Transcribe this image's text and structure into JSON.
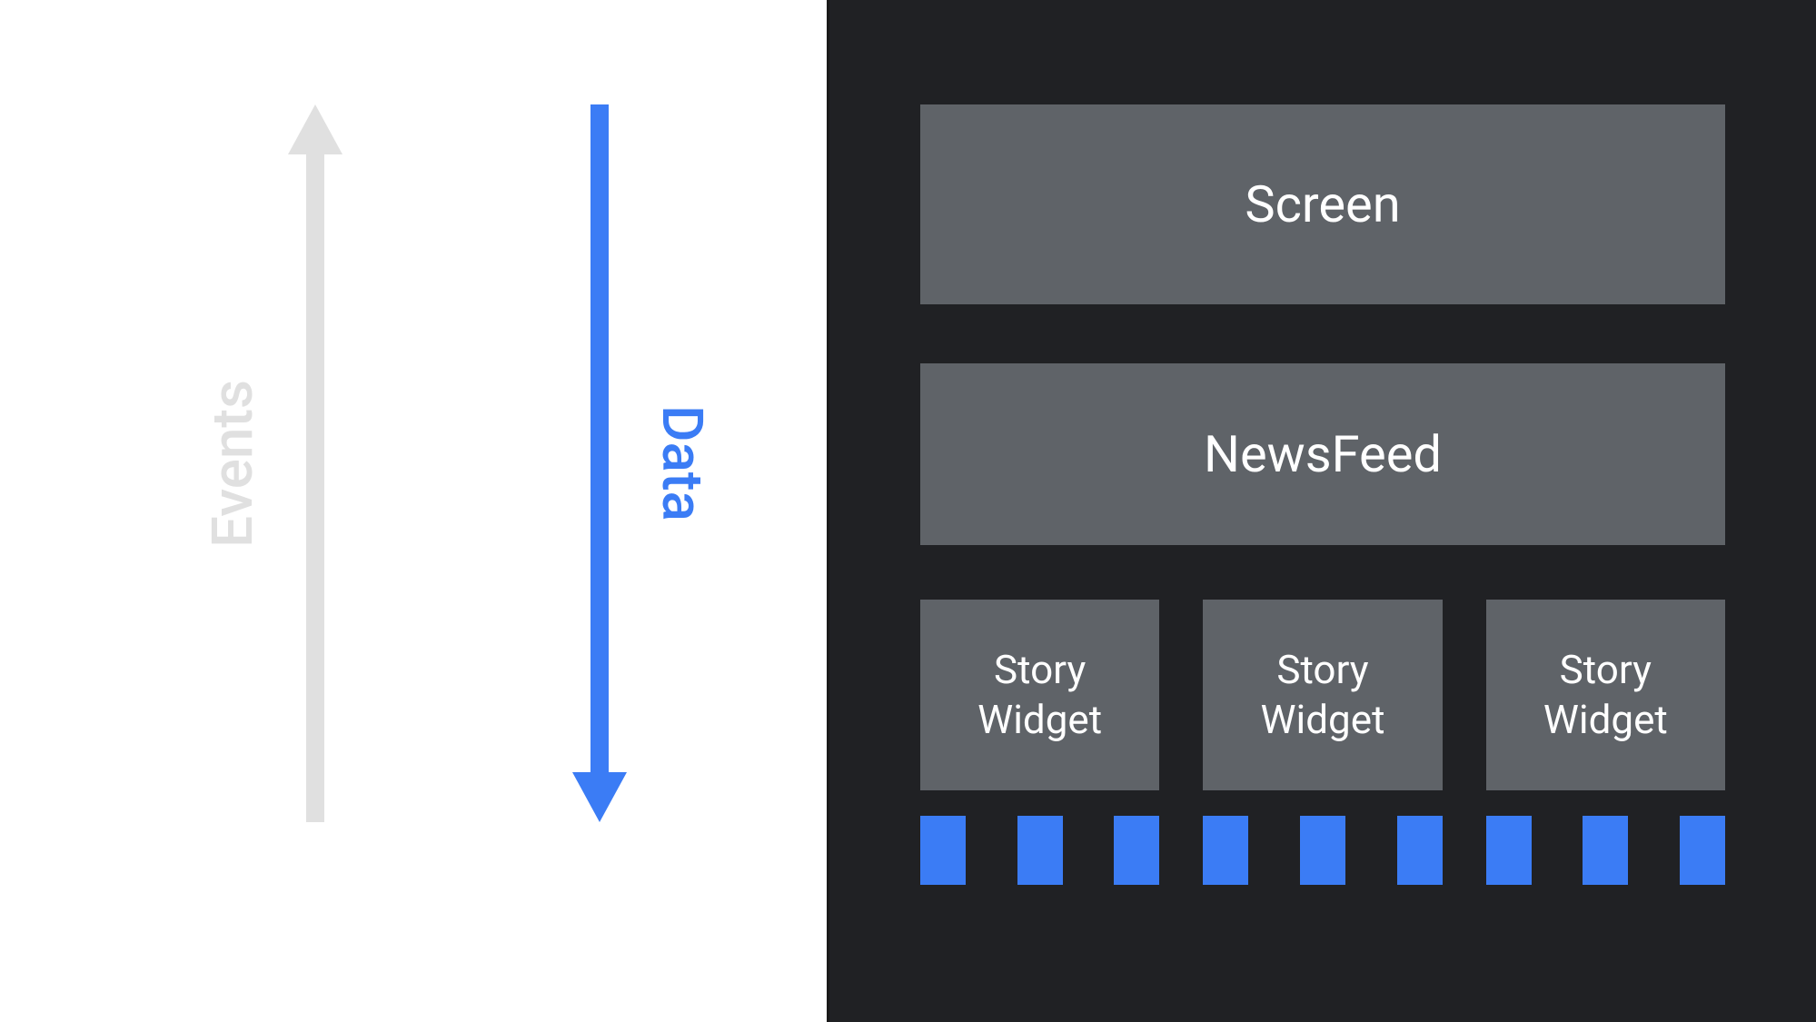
{
  "arrows": {
    "events_label": "Events",
    "data_label": "Data",
    "events_color": "#e0e0e0",
    "data_color": "#3b7cf5"
  },
  "hierarchy": {
    "screen_label": "Screen",
    "newsfeed_label": "NewsFeed",
    "story_widgets": [
      {
        "label": "Story\nWidget",
        "chips": 3
      },
      {
        "label": "Story\nWidget",
        "chips": 3
      },
      {
        "label": "Story\nWidget",
        "chips": 3
      }
    ]
  },
  "colors": {
    "panel_dark": "#202124",
    "box_gray": "#5f6368",
    "accent_blue": "#3b7cf5",
    "arrow_gray": "#e0e0e0"
  }
}
